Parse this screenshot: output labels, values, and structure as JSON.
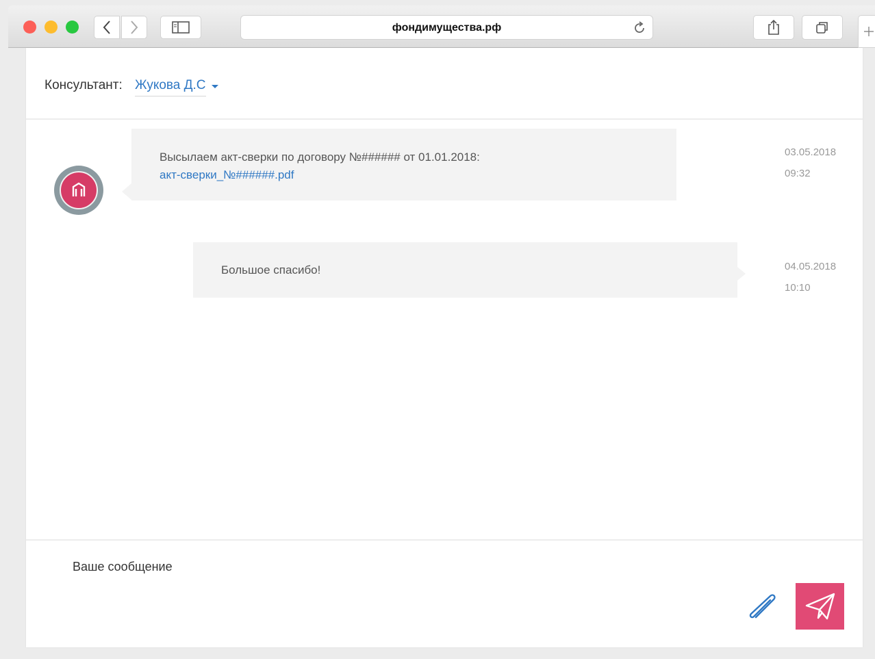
{
  "browser": {
    "url": "фондимущества.рф",
    "icons": {
      "back": "chevron-left-icon",
      "forward": "chevron-right-icon",
      "sidebar": "sidebar-icon",
      "reload": "reload-icon",
      "share": "share-icon",
      "tabs": "tabs-icon",
      "new_tab": "plus-icon"
    }
  },
  "consultant": {
    "label": "Консультант:",
    "name": "Жукова Д.С"
  },
  "messages": [
    {
      "text": "Высылаем акт-сверки по договору №###### от 01.01.2018:",
      "link": "акт-сверки_№######.pdf",
      "date": "03.05.2018",
      "time": "09:32"
    },
    {
      "text": "Большое спасибо!",
      "date": "04.05.2018",
      "time": "10:10"
    }
  ],
  "compose": {
    "placeholder": "Ваше сообщение"
  },
  "colors": {
    "accent": "#e14a75",
    "link": "#2f78c4",
    "bubble": "#f3f3f3"
  }
}
